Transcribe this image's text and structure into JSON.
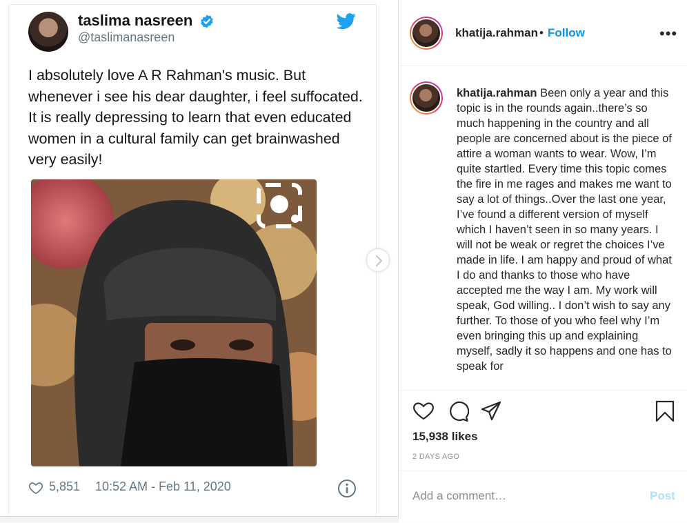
{
  "tweet": {
    "name": "taslima nasreen",
    "handle": "@taslimanasreen",
    "text": "I absolutely love A R Rahman's music. But whenever i see his dear daughter, i feel suffocated. It is really depressing to learn that even  educated women in a  cultural family can get brainwashed very easily!",
    "likes": "5,851",
    "timestamp": "10:52 AM - Feb 11, 2020",
    "colors": {
      "twitter_blue": "#1da1f2",
      "text": "#14171a",
      "muted": "#657786"
    },
    "icons": [
      "verified-badge-icon",
      "twitter-bird-icon",
      "heart-icon",
      "info-icon",
      "lens-icon"
    ]
  },
  "instagram": {
    "username": "khatija.rahman",
    "separator": "•",
    "follow_label": "Follow",
    "more_label": "•••",
    "caption_user": "khatija.rahman",
    "caption_text": "Been only a year and this topic is in the rounds again..there’s so much happening in the country and all people are concerned about is the piece of attire a woman wants to wear. Wow, I’m quite startled. Every time this topic comes the fire in me rages and makes me want to say a lot of things..Over the last one year, I’ve found a different version of myself which I haven’t seen in so many years. I will not be weak or regret the choices I’ve made in life. I am happy and proud of what I do and thanks to those who have accepted me the way I am. My work will speak, God willing.. I don’t wish to say any further. To those of you who feel why I’m even bringing this up and explaining myself, sadly it so happens and one has to speak for",
    "likes": "15,938 likes",
    "posted": "2 DAYS AGO",
    "comment_placeholder": "Add a comment…",
    "post_label": "Post",
    "colors": {
      "link": "#0095f6",
      "post_disabled": "#b2dffc",
      "text": "#262626",
      "muted": "#8e8e8e"
    },
    "icons": [
      "heart-icon",
      "comment-icon",
      "share-icon",
      "bookmark-icon",
      "chevron-right-icon"
    ]
  }
}
